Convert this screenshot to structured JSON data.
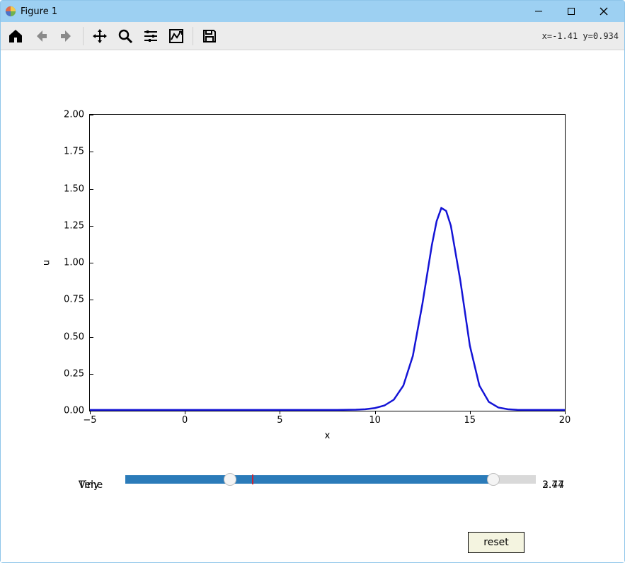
{
  "window": {
    "title": "Figure 1"
  },
  "toolbar": {
    "coords": "x=-1.41 y=0.934"
  },
  "sliders": {
    "label1": "Time",
    "label2": "Vely",
    "value1": "3.74",
    "value2": "2.47",
    "thumb1_frac": 0.256,
    "thumb2_frac": 0.896,
    "mark_frac": 0.309
  },
  "reset_label": "reset",
  "chart_data": {
    "type": "line",
    "xlabel": "x",
    "ylabel": "u",
    "xlim": [
      -5,
      20
    ],
    "ylim": [
      0,
      2
    ],
    "xticks": [
      -5,
      0,
      5,
      10,
      15,
      20
    ],
    "yticks": [
      0.0,
      0.25,
      0.5,
      0.75,
      1.0,
      1.25,
      1.5,
      1.75,
      2.0
    ],
    "series": [
      {
        "name": "u",
        "color": "#1414d6",
        "x": [
          -5,
          -4,
          -3,
          -2,
          -1,
          0,
          1,
          2,
          3,
          4,
          5,
          6,
          7,
          8,
          9,
          9.5,
          10,
          10.5,
          11,
          11.5,
          12,
          12.5,
          13,
          13.25,
          13.5,
          13.75,
          14,
          14.5,
          15,
          15.5,
          16,
          16.5,
          17,
          17.5,
          18,
          19,
          20
        ],
        "y": [
          0.005,
          0.005,
          0.005,
          0.005,
          0.005,
          0.005,
          0.005,
          0.005,
          0.005,
          0.005,
          0.005,
          0.005,
          0.005,
          0.005,
          0.007,
          0.01,
          0.018,
          0.035,
          0.075,
          0.17,
          0.37,
          0.72,
          1.12,
          1.28,
          1.37,
          1.35,
          1.25,
          0.88,
          0.44,
          0.17,
          0.06,
          0.022,
          0.01,
          0.006,
          0.005,
          0.005,
          0.005
        ]
      }
    ]
  }
}
